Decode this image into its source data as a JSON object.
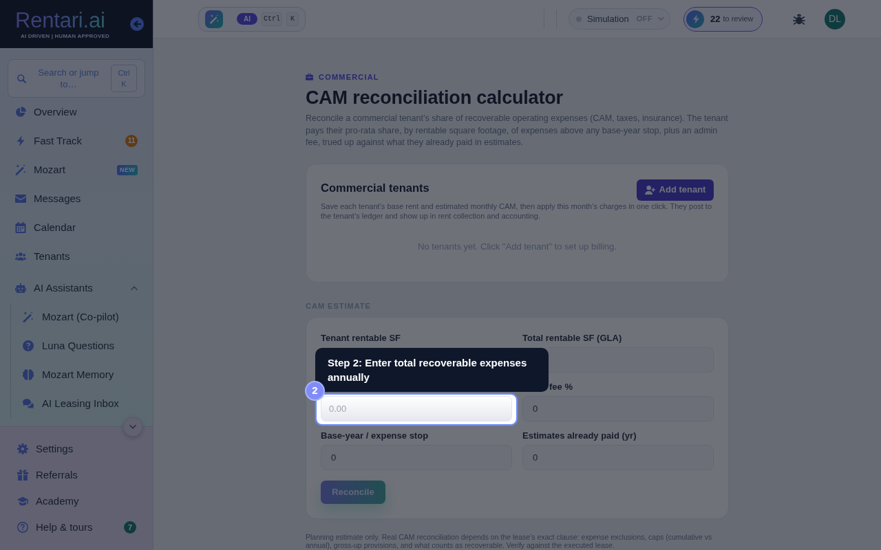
{
  "sidebar": {
    "brand": {
      "name": "Rentari.ai",
      "tagline": "AI DRIVEN | HUMAN APPROVED"
    },
    "search": {
      "placeholder": "Search or jump to…",
      "shortcut": "Ctrl K"
    },
    "nav": [
      {
        "label": "Overview",
        "selected": false
      },
      {
        "label": "Fast Track",
        "selected": false,
        "badge": {
          "text": "11",
          "kind": "alert"
        }
      },
      {
        "label": "Mozart",
        "selected": false,
        "badge": {
          "text": "NEW",
          "kind": "new"
        }
      },
      {
        "label": "Messages",
        "selected": false
      },
      {
        "label": "Calendar",
        "selected": false
      },
      {
        "label": "Tenants",
        "selected": false
      },
      {
        "label": "AI Assistants",
        "selected": false,
        "expanded": true,
        "children": [
          {
            "label": "Mozart (Co-pilot)",
            "selected": false
          },
          {
            "label": "Luna Questions",
            "selected": false
          },
          {
            "label": "Mozart Memory",
            "selected": false
          },
          {
            "label": "AI Leasing Inbox",
            "selected": false
          }
        ]
      }
    ],
    "footer_nav": [
      {
        "label": "Settings",
        "selected": false
      },
      {
        "label": "Referrals",
        "selected": false
      },
      {
        "label": "Academy",
        "selected": false
      },
      {
        "label": "Help & tours",
        "selected": false,
        "badge": {
          "text": "7",
          "kind": "count"
        }
      }
    ]
  },
  "topbar": {
    "ai_command": {
      "badge": "AI",
      "keys": [
        "Ctrl",
        "K"
      ]
    },
    "simulation": {
      "label": "Simulation",
      "state": "OFF",
      "on": false
    },
    "review": {
      "count": "22",
      "label": "to review"
    },
    "user": {
      "initials": "DL"
    }
  },
  "page": {
    "eyebrow": "COMMERCIAL",
    "title": "CAM reconciliation calculator",
    "description": "Reconcile a commercial tenant’s share of recoverable operating expenses (CAM, taxes, insurance). The tenant pays their pro-rata share, by rentable square footage, of expenses above any base-year stop, plus an admin fee, trued up against what they already paid in estimates.",
    "tenants": {
      "title": "Commercial tenants",
      "description": "Save each tenant’s base rent and estimated monthly CAM, then apply this month’s charges in one click. They post to the tenant’s ledger and show up in rent collection and accounting.",
      "add_button": "Add tenant",
      "empty_message": "No tenants yet. Click \"Add tenant\" to set up billing."
    },
    "estimate": {
      "section_label": "CAM ESTIMATE",
      "fields": [
        {
          "label": "Tenant rentable SF"
        },
        {
          "label": "Total rentable SF (GLA)",
          "input": {
            "highlighted": false
          }
        },
        {
          "input": {
            "placeholder": "0.00",
            "highlighted": true
          }
        },
        {
          "label": "fee %",
          "input": {
            "value": "0",
            "highlighted": false
          }
        },
        {
          "label": "Base-year / expense stop",
          "input": {
            "value": "0",
            "highlighted": false
          }
        },
        {
          "label": "Estimates already paid (yr)",
          "input": {
            "value": "0",
            "highlighted": false
          }
        }
      ],
      "button": {
        "label": "Reconcile",
        "disabled": true
      }
    },
    "footnote": "Planning estimate only. Real CAM reconciliation depends on the lease’s exact clause: expense exclusions, caps (cumulative vs annual), gross-up provisions, and what counts as recoverable. Verify against the executed lease."
  },
  "tour": {
    "step": "2",
    "text": "Step 2: Enter total recoverable expenses annually"
  }
}
